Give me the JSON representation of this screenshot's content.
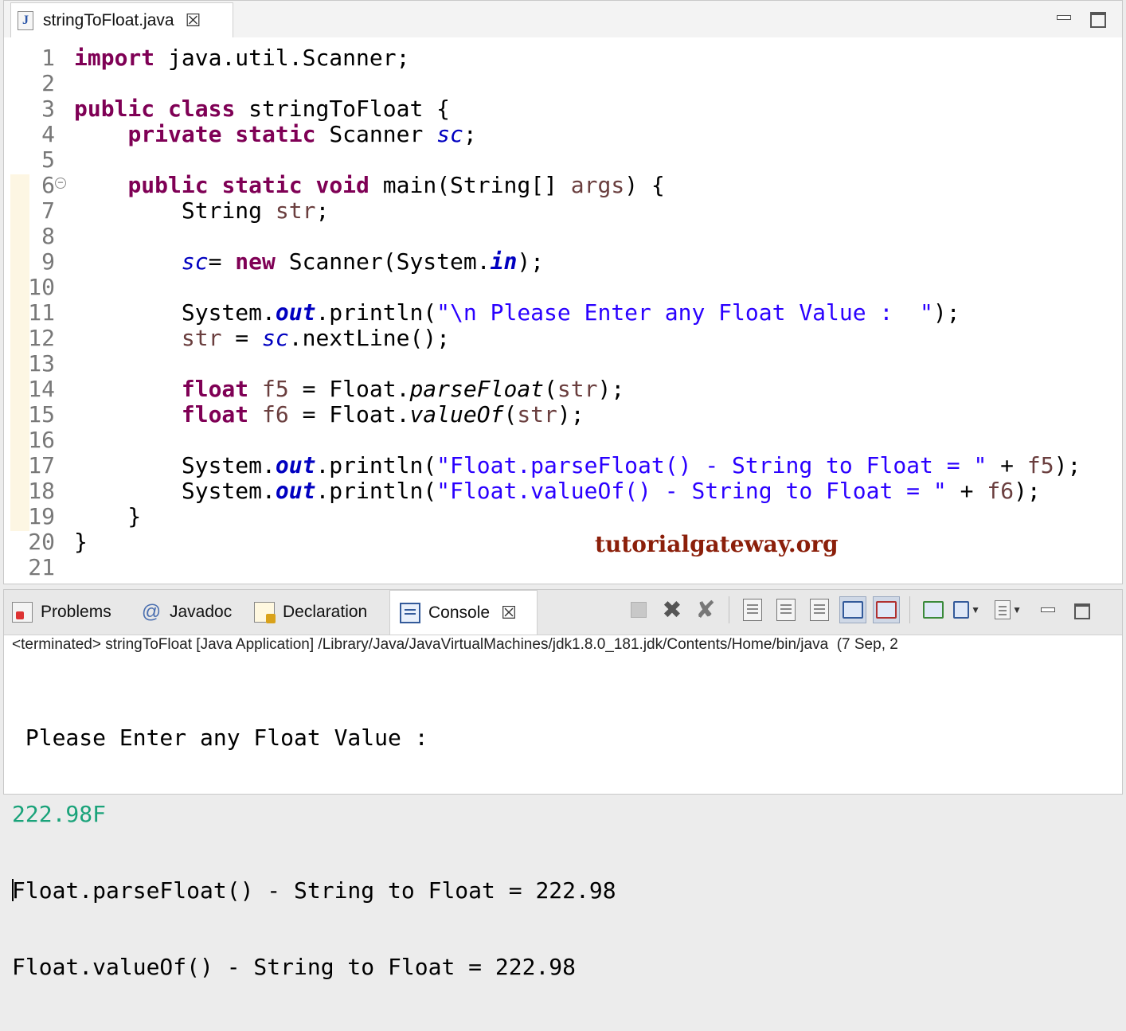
{
  "editor": {
    "tab_title": "stringToFloat.java",
    "tab_icon": "java-file-icon",
    "lines": [
      {
        "n": "1",
        "tokens": [
          {
            "t": "import",
            "c": "kw"
          },
          {
            "t": " java.util.Scanner;",
            "c": ""
          }
        ]
      },
      {
        "n": "2",
        "tokens": []
      },
      {
        "n": "3",
        "tokens": [
          {
            "t": "public",
            "c": "kw"
          },
          {
            "t": " ",
            "c": ""
          },
          {
            "t": "class",
            "c": "kw"
          },
          {
            "t": " stringToFloat {",
            "c": ""
          }
        ]
      },
      {
        "n": "4",
        "tokens": [
          {
            "t": "    ",
            "c": ""
          },
          {
            "t": "private",
            "c": "kw"
          },
          {
            "t": " ",
            "c": ""
          },
          {
            "t": "static",
            "c": "kw"
          },
          {
            "t": " Scanner ",
            "c": ""
          },
          {
            "t": "sc",
            "c": "fld"
          },
          {
            "t": ";",
            "c": ""
          }
        ]
      },
      {
        "n": "5",
        "tokens": []
      },
      {
        "n": "6",
        "fold": true,
        "tokens": [
          {
            "t": "    ",
            "c": ""
          },
          {
            "t": "public",
            "c": "kw"
          },
          {
            "t": " ",
            "c": ""
          },
          {
            "t": "static",
            "c": "kw"
          },
          {
            "t": " ",
            "c": ""
          },
          {
            "t": "void",
            "c": "kw"
          },
          {
            "t": " main(String[] ",
            "c": ""
          },
          {
            "t": "args",
            "c": "var"
          },
          {
            "t": ") {",
            "c": ""
          }
        ]
      },
      {
        "n": "7",
        "tokens": [
          {
            "t": "        String ",
            "c": ""
          },
          {
            "t": "str",
            "c": "var"
          },
          {
            "t": ";",
            "c": ""
          }
        ]
      },
      {
        "n": "8",
        "tokens": []
      },
      {
        "n": "9",
        "tokens": [
          {
            "t": "        ",
            "c": ""
          },
          {
            "t": "sc",
            "c": "fld"
          },
          {
            "t": "= ",
            "c": ""
          },
          {
            "t": "new",
            "c": "kw"
          },
          {
            "t": " Scanner(System.",
            "c": ""
          },
          {
            "t": "in",
            "c": "fldb"
          },
          {
            "t": ");",
            "c": ""
          }
        ]
      },
      {
        "n": "10",
        "tokens": []
      },
      {
        "n": "11",
        "tokens": [
          {
            "t": "        System.",
            "c": ""
          },
          {
            "t": "out",
            "c": "fldb"
          },
          {
            "t": ".println(",
            "c": ""
          },
          {
            "t": "\"\\n Please Enter any Float Value :  \"",
            "c": "str"
          },
          {
            "t": ");",
            "c": ""
          }
        ]
      },
      {
        "n": "12",
        "tokens": [
          {
            "t": "        ",
            "c": ""
          },
          {
            "t": "str",
            "c": "var"
          },
          {
            "t": " = ",
            "c": ""
          },
          {
            "t": "sc",
            "c": "fld"
          },
          {
            "t": ".nextLine();",
            "c": ""
          }
        ]
      },
      {
        "n": "13",
        "tokens": []
      },
      {
        "n": "14",
        "tokens": [
          {
            "t": "        ",
            "c": ""
          },
          {
            "t": "float",
            "c": "kw"
          },
          {
            "t": " ",
            "c": ""
          },
          {
            "t": "f5",
            "c": "var"
          },
          {
            "t": " = Float.",
            "c": ""
          },
          {
            "t": "parseFloat",
            "c": "meth"
          },
          {
            "t": "(",
            "c": ""
          },
          {
            "t": "str",
            "c": "var"
          },
          {
            "t": ");",
            "c": ""
          }
        ]
      },
      {
        "n": "15",
        "tokens": [
          {
            "t": "        ",
            "c": ""
          },
          {
            "t": "float",
            "c": "kw"
          },
          {
            "t": " ",
            "c": ""
          },
          {
            "t": "f6",
            "c": "var"
          },
          {
            "t": " = Float.",
            "c": ""
          },
          {
            "t": "valueOf",
            "c": "meth"
          },
          {
            "t": "(",
            "c": ""
          },
          {
            "t": "str",
            "c": "var"
          },
          {
            "t": ");",
            "c": ""
          }
        ]
      },
      {
        "n": "16",
        "tokens": []
      },
      {
        "n": "17",
        "tokens": [
          {
            "t": "        System.",
            "c": ""
          },
          {
            "t": "out",
            "c": "fldb"
          },
          {
            "t": ".println(",
            "c": ""
          },
          {
            "t": "\"Float.parseFloat() - String to Float = \"",
            "c": "str"
          },
          {
            "t": " + ",
            "c": ""
          },
          {
            "t": "f5",
            "c": "var"
          },
          {
            "t": ");",
            "c": ""
          }
        ]
      },
      {
        "n": "18",
        "tokens": [
          {
            "t": "        System.",
            "c": ""
          },
          {
            "t": "out",
            "c": "fldb"
          },
          {
            "t": ".println(",
            "c": ""
          },
          {
            "t": "\"Float.valueOf() - String to Float = \"",
            "c": "str"
          },
          {
            "t": " + ",
            "c": ""
          },
          {
            "t": "f6",
            "c": "var"
          },
          {
            "t": ");",
            "c": ""
          }
        ]
      },
      {
        "n": "19",
        "tokens": [
          {
            "t": "    }",
            "c": ""
          }
        ]
      },
      {
        "n": "20",
        "tokens": [
          {
            "t": "}",
            "c": ""
          }
        ]
      },
      {
        "n": "21",
        "tokens": []
      }
    ],
    "watermark": "tutorialgateway.org"
  },
  "console_view": {
    "tabs": [
      {
        "label": "Problems",
        "icon": "problems-icon"
      },
      {
        "label": "Javadoc",
        "icon": "javadoc-icon"
      },
      {
        "label": "Declaration",
        "icon": "declaration-icon"
      },
      {
        "label": "Console",
        "icon": "console-icon"
      }
    ],
    "status": "<terminated> stringToFloat [Java Application] /Library/Java/JavaVirtualMachines/jdk1.8.0_181.jdk/Contents/Home/bin/java  (7 Sep, 2",
    "output": {
      "prompt": " Please Enter any Float Value :  ",
      "input": "222.98F",
      "line1": "Float.parseFloat() - String to Float = 222.98",
      "line2": "Float.valueOf() - String to Float = 222.98"
    }
  },
  "colors": {
    "keyword": "#7f0055",
    "string": "#2a00ff",
    "field": "#0000c0",
    "local_var": "#6a3e3e",
    "console_input": "#1aa37a",
    "watermark": "#8b1f0a"
  }
}
